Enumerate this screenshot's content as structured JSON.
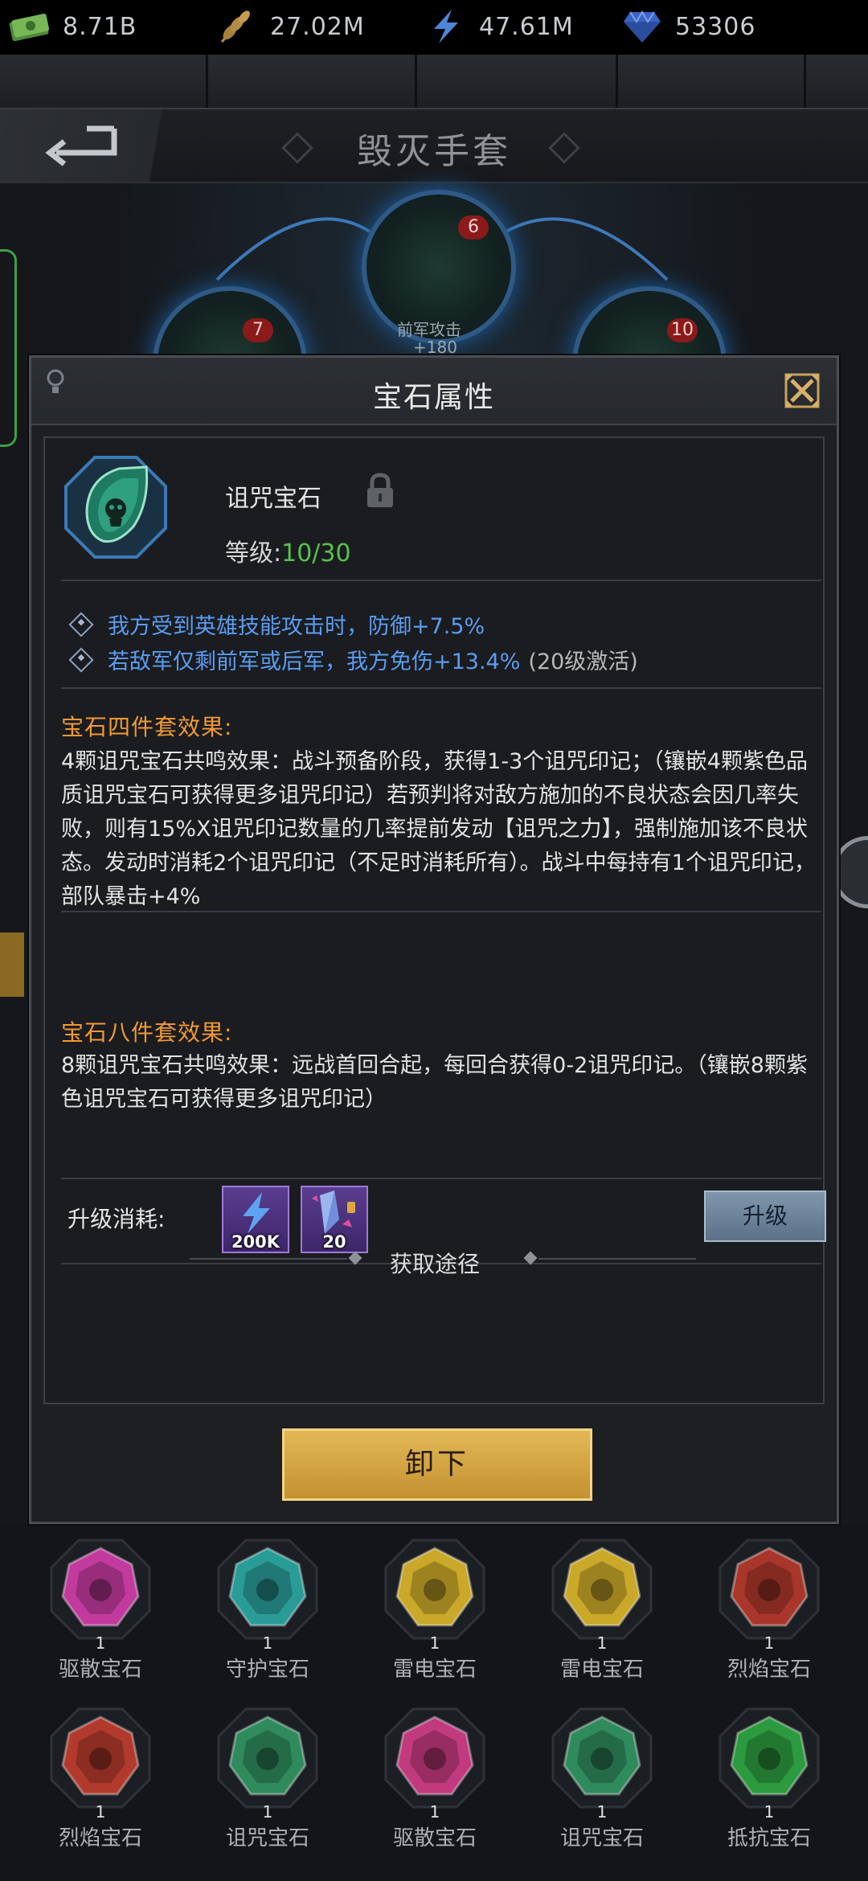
{
  "resources": [
    {
      "icon": "cash-icon",
      "value": "8.71B"
    },
    {
      "icon": "wheat-icon",
      "value": "27.02M"
    },
    {
      "icon": "lightning-icon",
      "value": "47.61M"
    },
    {
      "icon": "diamond-icon",
      "value": "53306"
    }
  ],
  "page": {
    "title": "毁灭手套"
  },
  "scene": {
    "slots": [
      {
        "badge": "6",
        "label": "前军攻击",
        "sub": "+180"
      },
      {
        "badge": "7"
      },
      {
        "badge": "10"
      }
    ]
  },
  "modal": {
    "title": "宝石属性",
    "gem": {
      "name": "诅咒宝石",
      "level_prefix": "等级:",
      "level_current": "10",
      "level_max": "/30"
    },
    "attributes": [
      {
        "text": "我方受到英雄技能攻击时，防御+7.5%",
        "extra": ""
      },
      {
        "text": "若敌军仅剩前军或后军，我方免伤+13.4%",
        "extra": "(20级激活)"
      }
    ],
    "set4": {
      "title": "宝石四件套效果:",
      "body": "4颗诅咒宝石共鸣效果：战斗预备阶段，获得1-3个诅咒印记；（镶嵌4颗紫色品质诅咒宝石可获得更多诅咒印记）若预判将对敌方施加的不良状态会因几率失败，则有15%X诅咒印记数量的几率提前发动【诅咒之力】，强制施加该不良状态。发动时消耗2个诅咒印记（不足时消耗所有）。战斗中每持有1个诅咒印记，部队暴击+4%"
    },
    "set8": {
      "title": "宝石八件套效果:",
      "body": "8颗诅咒宝石共鸣效果：远战首回合起，每回合获得0-2诅咒印记。（镶嵌8颗紫色诅咒宝石可获得更多诅咒印记）"
    },
    "cost": {
      "label": "升级消耗:",
      "items": [
        {
          "icon": "energy-icon",
          "count": "200K"
        },
        {
          "icon": "crystal-shard-icon",
          "count": "20"
        }
      ],
      "upgrade_label": "升级"
    },
    "source_label": "获取途径",
    "unload_label": "卸下"
  },
  "colors": {
    "accent_green": "#58c24b",
    "attr_blue": "#5b9cf0",
    "section_orange": "#f29a35",
    "button_gold": "#d7a843"
  },
  "gem_grid": [
    {
      "name": "驱散宝石",
      "count": "1",
      "icon": "dispel-gem-icon",
      "color": "#c23a9e"
    },
    {
      "name": "守护宝石",
      "count": "1",
      "icon": "guard-gem-icon",
      "color": "#2a9c98"
    },
    {
      "name": "雷电宝石",
      "count": "1",
      "icon": "thunder-gem-icon",
      "color": "#c9a82a"
    },
    {
      "name": "雷电宝石",
      "count": "1",
      "icon": "thunder-gem-icon",
      "color": "#c9a82a"
    },
    {
      "name": "烈焰宝石",
      "count": "1",
      "icon": "flame-gem-icon",
      "color": "#a9362a"
    },
    {
      "name": "烈焰宝石",
      "count": "1",
      "icon": "flame-gem-icon",
      "color": "#b23a2c"
    },
    {
      "name": "诅咒宝石",
      "count": "1",
      "icon": "curse-gem-icon",
      "color": "#2f8a5c"
    },
    {
      "name": "驱散宝石",
      "count": "1",
      "icon": "dispel-gem-icon",
      "color": "#c23a7e"
    },
    {
      "name": "诅咒宝石",
      "count": "1",
      "icon": "curse-gem-icon",
      "color": "#2f8a5c"
    },
    {
      "name": "抵抗宝石",
      "count": "1",
      "icon": "resist-gem-icon",
      "color": "#2c9a3e"
    }
  ]
}
